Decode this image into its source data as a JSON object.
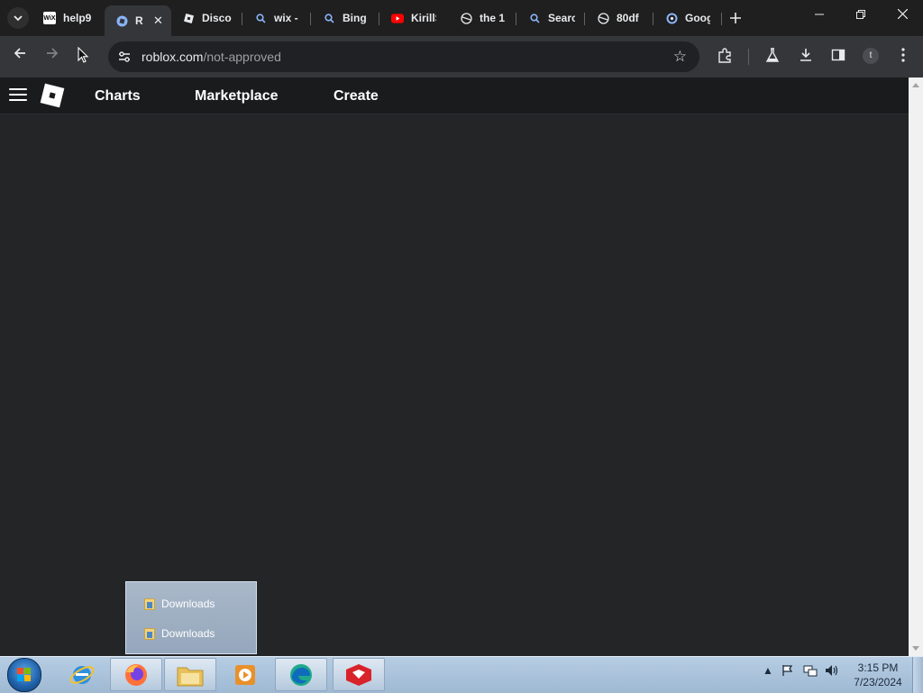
{
  "browser": {
    "tabs": [
      {
        "title": "help9",
        "favicon": "wix-icon",
        "favicon_text": "WiX",
        "active": false
      },
      {
        "title": "R",
        "favicon": "roblox-icon",
        "active": true
      },
      {
        "title": "Disco",
        "favicon": "roblox-icon",
        "active": false
      },
      {
        "title": "wix -",
        "favicon": "search-icon",
        "active": false
      },
      {
        "title": "Bing",
        "favicon": "search-icon",
        "active": false
      },
      {
        "title": "KirillS",
        "favicon": "youtube-icon",
        "active": false
      },
      {
        "title": "the 1",
        "favicon": "globe-icon",
        "active": false
      },
      {
        "title": "Searc",
        "favicon": "search-icon",
        "active": false
      },
      {
        "title": "80df",
        "favicon": "globe-icon",
        "active": false
      },
      {
        "title": "Goog",
        "favicon": "google-lens-icon",
        "active": false
      }
    ],
    "address": {
      "host": "roblox.com",
      "path": "/not-approved"
    },
    "profile_initial": "t"
  },
  "roblox_nav": {
    "links": [
      {
        "label": "Charts"
      },
      {
        "label": "Marketplace"
      },
      {
        "label": "Create"
      }
    ]
  },
  "jumplist": {
    "items": [
      {
        "label": "Downloads"
      },
      {
        "label": "Downloads"
      }
    ]
  },
  "taskbar": {
    "apps": [
      "internet-explorer",
      "firefox",
      "file-explorer",
      "media-player",
      "edge",
      "gamemaker"
    ],
    "clock": {
      "time": "3:15 PM",
      "date": "7/23/2024"
    }
  }
}
